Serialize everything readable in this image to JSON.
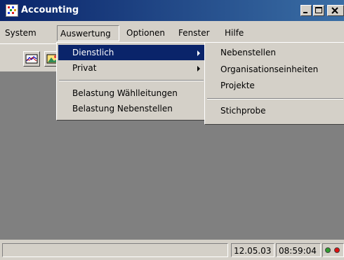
{
  "window": {
    "title": "Accounting",
    "app_icon": "accounting-app-icon"
  },
  "caption_buttons": [
    "minimize-icon",
    "maximize-icon",
    "close-icon"
  ],
  "menubar": {
    "system": "System",
    "auswertung": "Auswertung",
    "optionen": "Optionen",
    "fenster": "Fenster",
    "hilfe": "Hilfe"
  },
  "toolbar": {
    "buttons": [
      "line-chart-icon",
      "picture-icon"
    ]
  },
  "auswertung_menu": {
    "dienstlich": "Dienstlich",
    "privat": "Privat",
    "belastung_waehlleitungen": "Belastung Wählleitungen",
    "belastung_nebenstellen": "Belastung Nebenstellen"
  },
  "dienstlich_submenu": {
    "nebenstellen": "Nebenstellen",
    "organisationseinheiten": "Organisationseinheiten",
    "projekte": "Projekte",
    "stichprobe": "Stichprobe"
  },
  "status": {
    "date": "12.05.03",
    "time": "08:59:04",
    "indicator_colors": [
      "#2e9e2e",
      "#e01010"
    ]
  },
  "colors": {
    "titlebar_start": "#0a246a",
    "titlebar_end": "#3a6ea5",
    "selection": "#0a246a",
    "client_background": "#808080",
    "face": "#d4d0c8"
  }
}
